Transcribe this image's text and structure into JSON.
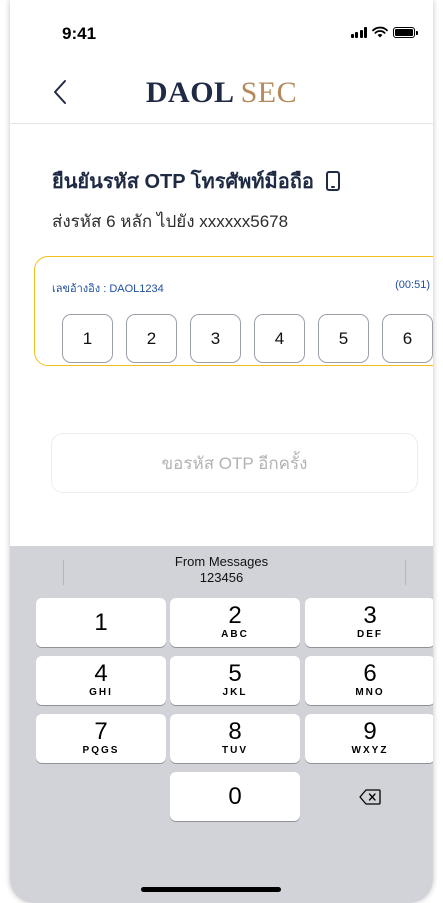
{
  "status_bar": {
    "time": "9:41"
  },
  "header": {
    "logo_primary": "DAOL",
    "logo_secondary": "SEC"
  },
  "content": {
    "title": "ยืนยันรหัส OTP โทรศัพท์มือถือ",
    "subtitle": "ส่งรหัส 6 หลัก ไปยัง xxxxxx5678",
    "reference": "เลขอ้างอิง : DAOL1234",
    "timer": "(00:51)",
    "otp_digits": [
      "1",
      "2",
      "3",
      "4",
      "5",
      "6"
    ],
    "resend_label": "ขอรหัส OTP อีกครั้ง"
  },
  "keyboard": {
    "suggestion_title": "From Messages",
    "suggestion_code": "123456",
    "keys": [
      {
        "num": "1",
        "letters": ""
      },
      {
        "num": "2",
        "letters": "ABC"
      },
      {
        "num": "3",
        "letters": "DEF"
      },
      {
        "num": "4",
        "letters": "GHI"
      },
      {
        "num": "5",
        "letters": "JKL"
      },
      {
        "num": "6",
        "letters": "MNO"
      },
      {
        "num": "7",
        "letters": "PQGS"
      },
      {
        "num": "8",
        "letters": "TUV"
      },
      {
        "num": "9",
        "letters": "WXYZ"
      },
      {
        "num": "0",
        "letters": ""
      }
    ],
    "delete_icon": "backspace-icon"
  },
  "colors": {
    "brand_navy": "#1f2a44",
    "brand_gold": "#b48a5a",
    "highlight_border": "#f2bd1d",
    "link_blue": "#1f4fa3"
  }
}
